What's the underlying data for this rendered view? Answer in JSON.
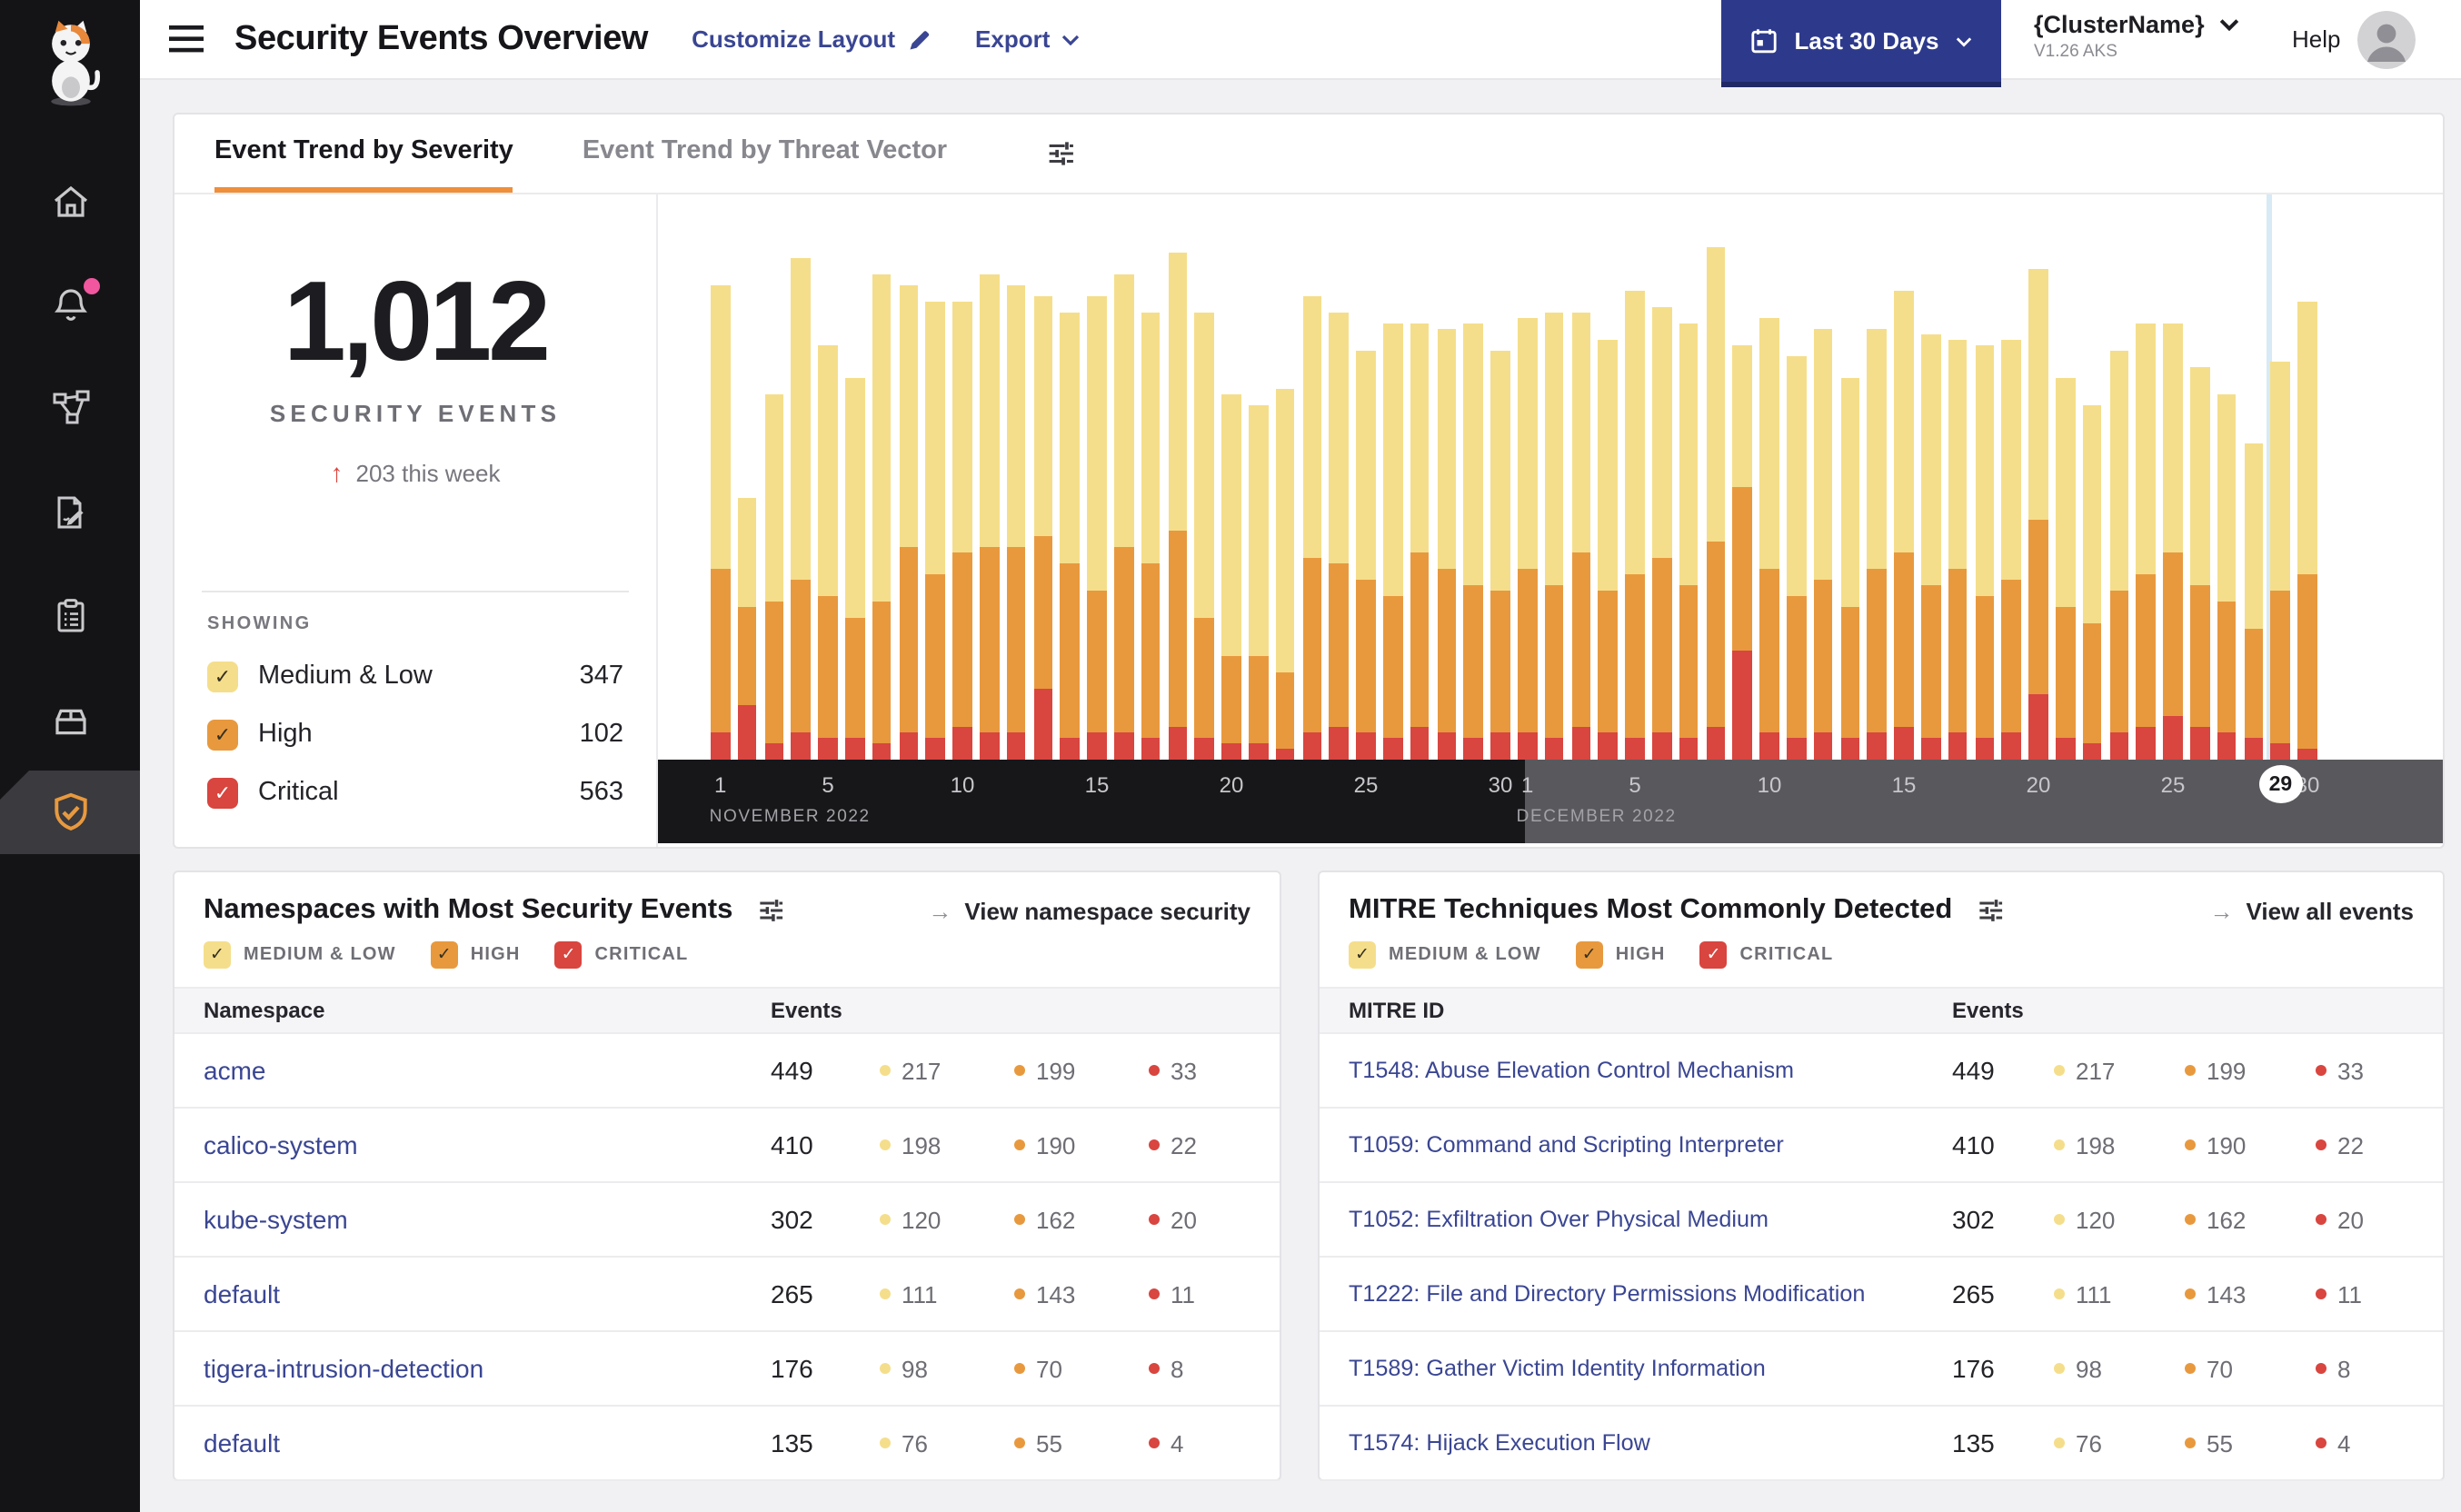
{
  "colors": {
    "medium": "#F5DE8B",
    "high": "#E8993E",
    "critical": "#D9453F",
    "link_navy": "#3A4693",
    "button_navy": "#2D3A8C",
    "tab_accent": "#EF8E3B",
    "badge_pink": "#F0579E",
    "selected_line_blue": "#D7EAF5"
  },
  "header": {
    "title": "Security Events Overview",
    "customize_label": "Customize Layout",
    "export_label": "Export",
    "date_range": "Last 30 Days",
    "cluster_name": "{ClusterName}",
    "cluster_version": "V1.26 AKS",
    "help_label": "Help"
  },
  "sidebar": {
    "icons": [
      "cat-logo",
      "home",
      "alerts-bell",
      "service-graph",
      "policies",
      "compliance-clipboard",
      "workloads-box",
      "threat-defense-shield"
    ],
    "active": "threat-defense-shield"
  },
  "trend_card": {
    "tabs": [
      {
        "label": "Event Trend by Severity",
        "active": true
      },
      {
        "label": "Event Trend by Threat Vector",
        "active": false
      }
    ],
    "stat": {
      "value": "1,012",
      "label": "SECURITY EVENTS",
      "delta": "203 this week"
    },
    "showing_label": "SHOWING",
    "legend": [
      {
        "label": "Medium & Low",
        "count": "347",
        "key": "medium"
      },
      {
        "label": "High",
        "count": "102",
        "key": "high"
      },
      {
        "label": "Critical",
        "count": "563",
        "key": "critical"
      }
    ]
  },
  "chart_data": {
    "type": "bar",
    "subtype": "stacked-daily",
    "title": "Event Trend by Severity",
    "x_unit": "day",
    "legend_position": "left-panel",
    "grid": false,
    "months": [
      {
        "label": "NOVEMBER 2022",
        "start_index": 0,
        "days": 30,
        "tick_days": [
          1,
          5,
          10,
          15,
          20,
          25,
          30
        ]
      },
      {
        "label": "DECEMBER 2022",
        "start_index": 30,
        "days": 30,
        "tick_days": [
          1,
          5,
          10,
          15,
          20,
          25,
          30
        ]
      }
    ],
    "selected_day": {
      "month_index": 1,
      "day": 29
    },
    "series": [
      {
        "name": "Critical",
        "key": "critical",
        "color": "#D9453F",
        "values": [
          5,
          10,
          3,
          5,
          4,
          4,
          3,
          5,
          4,
          6,
          5,
          5,
          13,
          4,
          5,
          5,
          4,
          6,
          4,
          3,
          3,
          2,
          5,
          6,
          5,
          4,
          6,
          5,
          4,
          5,
          5,
          4,
          6,
          5,
          4,
          5,
          4,
          6,
          20,
          5,
          4,
          5,
          4,
          5,
          6,
          4,
          5,
          4,
          5,
          12,
          4,
          3,
          5,
          6,
          8,
          6,
          5,
          4,
          3,
          2
        ]
      },
      {
        "name": "High",
        "key": "high",
        "color": "#E8993E",
        "values": [
          30,
          18,
          26,
          28,
          26,
          22,
          26,
          34,
          30,
          32,
          34,
          34,
          28,
          32,
          26,
          34,
          32,
          36,
          22,
          16,
          16,
          14,
          32,
          30,
          28,
          26,
          32,
          30,
          28,
          26,
          30,
          28,
          32,
          26,
          30,
          32,
          28,
          34,
          30,
          30,
          26,
          28,
          24,
          30,
          32,
          28,
          30,
          26,
          28,
          32,
          24,
          22,
          26,
          28,
          30,
          26,
          24,
          20,
          28,
          32
        ]
      },
      {
        "name": "Medium & Low",
        "key": "medium",
        "color": "#F5DE8B",
        "values": [
          52,
          20,
          38,
          59,
          46,
          44,
          60,
          48,
          50,
          46,
          50,
          48,
          44,
          46,
          54,
          50,
          46,
          51,
          56,
          48,
          46,
          52,
          48,
          46,
          42,
          50,
          42,
          44,
          48,
          44,
          46,
          50,
          44,
          46,
          52,
          46,
          48,
          54,
          26,
          46,
          44,
          46,
          42,
          44,
          48,
          46,
          42,
          46,
          44,
          46,
          42,
          40,
          44,
          46,
          42,
          40,
          38,
          34,
          42,
          50
        ]
      }
    ]
  },
  "namespaces_card": {
    "title": "Namespaces with Most Security Events",
    "link_label": "View namespace security",
    "filters": [
      {
        "label": "MEDIUM & LOW",
        "key": "medium"
      },
      {
        "label": "HIGH",
        "key": "high"
      },
      {
        "label": "CRITICAL",
        "key": "critical"
      }
    ],
    "columns": [
      "Namespace",
      "Events"
    ],
    "rows": [
      {
        "name": "acme",
        "total": "449",
        "medium": "217",
        "high": "199",
        "critical": "33"
      },
      {
        "name": "calico-system",
        "total": "410",
        "medium": "198",
        "high": "190",
        "critical": "22"
      },
      {
        "name": "kube-system",
        "total": "302",
        "medium": "120",
        "high": "162",
        "critical": "20"
      },
      {
        "name": "default",
        "total": "265",
        "medium": "111",
        "high": "143",
        "critical": "11"
      },
      {
        "name": "tigera-intrusion-detection",
        "total": "176",
        "medium": "98",
        "high": "70",
        "critical": "8"
      },
      {
        "name": "default",
        "total": "135",
        "medium": "76",
        "high": "55",
        "critical": "4"
      }
    ]
  },
  "mitre_card": {
    "title": "MITRE Techniques Most Commonly Detected",
    "link_label": "View all events",
    "filters": [
      {
        "label": "MEDIUM & LOW",
        "key": "medium"
      },
      {
        "label": "HIGH",
        "key": "high"
      },
      {
        "label": "CRITICAL",
        "key": "critical"
      }
    ],
    "columns": [
      "MITRE ID",
      "Events"
    ],
    "rows": [
      {
        "name": "T1548: Abuse Elevation Control Mechanism",
        "total": "449",
        "medium": "217",
        "high": "199",
        "critical": "33"
      },
      {
        "name": "T1059: Command and Scripting Interpreter",
        "total": "410",
        "medium": "198",
        "high": "190",
        "critical": "22"
      },
      {
        "name": "T1052: Exfiltration Over Physical Medium",
        "total": "302",
        "medium": "120",
        "high": "162",
        "critical": "20"
      },
      {
        "name": "T1222: File and Directory Permissions Modification",
        "total": "265",
        "medium": "111",
        "high": "143",
        "critical": "11"
      },
      {
        "name": "T1589: Gather Victim Identity Information",
        "total": "176",
        "medium": "98",
        "high": "70",
        "critical": "8"
      },
      {
        "name": "T1574: Hijack Execution Flow",
        "total": "135",
        "medium": "76",
        "high": "55",
        "critical": "4"
      }
    ]
  }
}
